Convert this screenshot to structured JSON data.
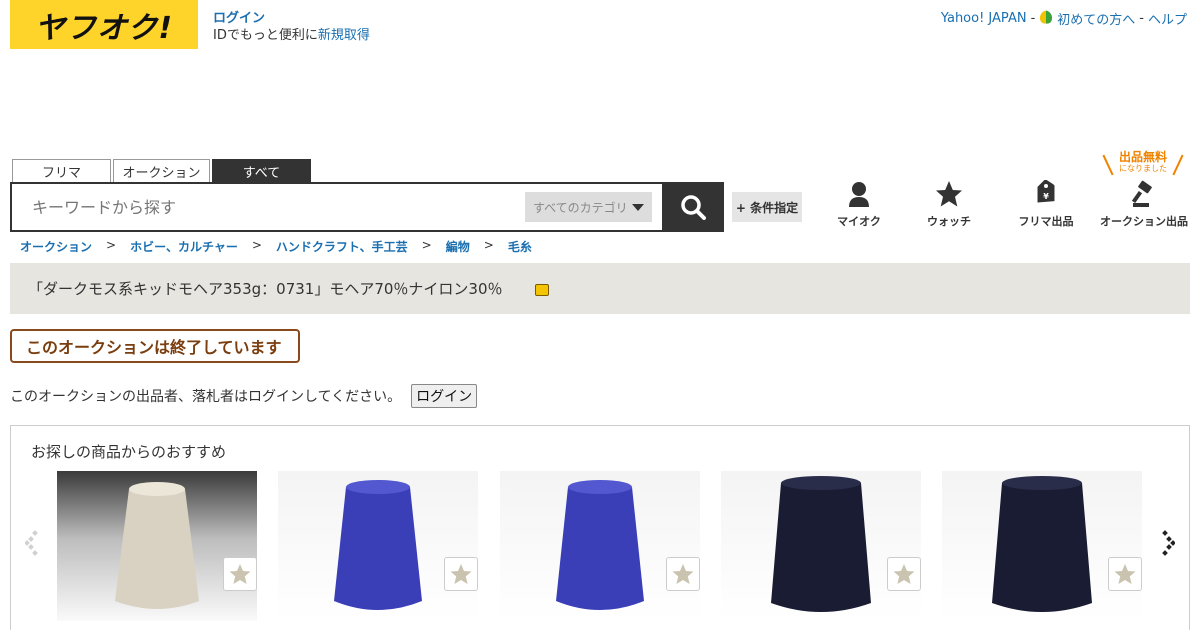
{
  "header": {
    "logo_text": "ヤフオク!",
    "login_label": "ログイン",
    "login_note_prefix": "IDでもっと便利に",
    "signup_label": "新規取得",
    "global_links": {
      "yahoo_japan": "Yahoo! JAPAN",
      "beginners": "初めての方へ",
      "help": "ヘルプ",
      "separator": "-"
    }
  },
  "search": {
    "tabs": [
      "フリマ",
      "オークション",
      "すべて"
    ],
    "active_tab": "すべて",
    "placeholder": "キーワードから探す",
    "category_select": "すべてのカテゴリ",
    "condition_button": "+ 条件指定"
  },
  "nav": {
    "items": [
      {
        "label": "マイオク",
        "icon": "person-icon"
      },
      {
        "label": "ウォッチ",
        "icon": "star-icon"
      },
      {
        "label": "フリマ出品",
        "icon": "price-tag-icon"
      },
      {
        "label": "オークション出品",
        "icon": "gavel-icon"
      }
    ],
    "free_listing_badge": "出品無料",
    "free_listing_sub": "になりました"
  },
  "breadcrumb": {
    "items": [
      "オークション",
      "ホビー、カルチャー",
      "ハンドクラフト、手工芸",
      "編物",
      "毛糸"
    ],
    "separator": ">"
  },
  "item": {
    "title": "「ダークモス系キッドモヘア353g：0731」モヘア70％ナイロン30％",
    "ended_banner": "このオークションは終了しています",
    "login_note": "このオークションの出品者、落札者はログインしてください。",
    "login_button": "ログイン"
  },
  "recommendations": {
    "title": "お探しの商品からのおすすめ",
    "items": [
      {
        "photo": "beige-yarn-cone",
        "color": "#d9d2c2"
      },
      {
        "photo": "blue-yarn-cone",
        "color": "#3a3fb8"
      },
      {
        "photo": "blue-yarn-cone",
        "color": "#3a3fb8"
      },
      {
        "photo": "navy-yarn-cone",
        "color": "#1a1c33"
      },
      {
        "photo": "navy-yarn-cone",
        "color": "#1a1c33"
      }
    ]
  },
  "colors": {
    "brand_yellow": "#ffd42a",
    "link_blue": "#1a6fb0",
    "ended_brown": "#8b4a1b",
    "free_orange": "#f08300"
  }
}
